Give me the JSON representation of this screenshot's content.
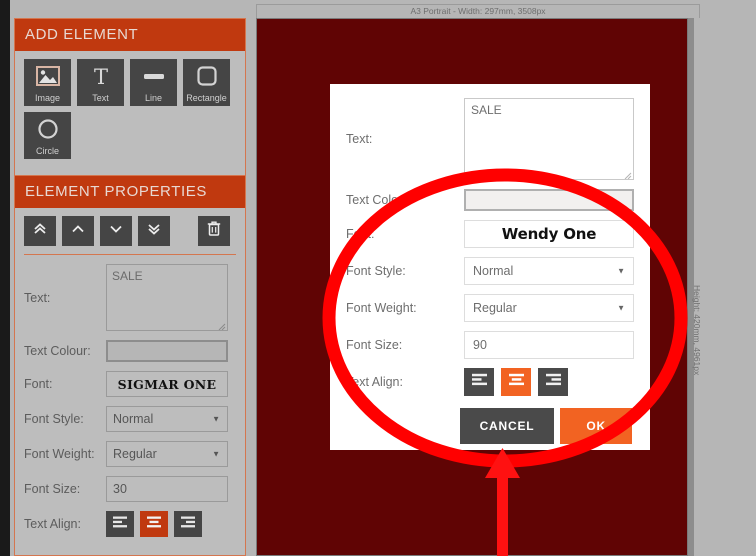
{
  "sidebar": {
    "add_element": {
      "title": "ADD ELEMENT",
      "tools": [
        {
          "label": "Image",
          "icon": "image-icon"
        },
        {
          "label": "Text",
          "icon": "text-icon"
        },
        {
          "label": "Line",
          "icon": "line-icon"
        },
        {
          "label": "Rectangle",
          "icon": "rectangle-icon"
        },
        {
          "label": "Circle",
          "icon": "circle-icon"
        }
      ]
    },
    "element_properties": {
      "title": "ELEMENT PROPERTIES",
      "nav": [
        {
          "name": "move-to-front",
          "icon": "double-chevron-up-icon"
        },
        {
          "name": "move-up",
          "icon": "chevron-up-icon"
        },
        {
          "name": "move-down",
          "icon": "chevron-down-icon"
        },
        {
          "name": "move-to-back",
          "icon": "double-chevron-down-icon"
        },
        {
          "name": "delete",
          "icon": "trash-icon"
        }
      ],
      "fields": {
        "text_label": "Text:",
        "text_value": "SALE",
        "text_colour_label": "Text Colour:",
        "text_colour_value": "",
        "font_label": "Font:",
        "font_value": "SIGMAR ONE",
        "font_style_label": "Font Style:",
        "font_style_value": "Normal",
        "font_weight_label": "Font Weight:",
        "font_weight_value": "Regular",
        "font_size_label": "Font Size:",
        "font_size_value": "30",
        "text_align_label": "Text Align:",
        "text_align_value": "center"
      }
    }
  },
  "canvas": {
    "ruler_top": "A3 Portrait - Width: 297mm, 3508px",
    "ruler_right": "Height: 420mm, 4961px",
    "background_colour": "#600404"
  },
  "modal": {
    "fields": {
      "text_label": "Text:",
      "text_value": "SALE",
      "text_colour_label": "Text Colour:",
      "text_colour_value": "",
      "font_label": "Font:",
      "font_value": "Wendy One",
      "font_style_label": "Font Style:",
      "font_style_value": "Normal",
      "font_weight_label": "Font Weight:",
      "font_weight_value": "Regular",
      "font_size_label": "Font Size:",
      "font_size_value": "90",
      "text_align_label": "Text Align:",
      "text_align_value": "center"
    },
    "buttons": {
      "cancel": "CANCEL",
      "ok": "OK"
    }
  },
  "annotations": {
    "ellipse_colour": "#ff0000",
    "arrow_colour": "#ff1111"
  },
  "colors": {
    "panel_header": "#c0390f",
    "accent_orange": "#f26322",
    "sidebar_bg": "#b6b6b6",
    "button_dark": "#454545"
  }
}
